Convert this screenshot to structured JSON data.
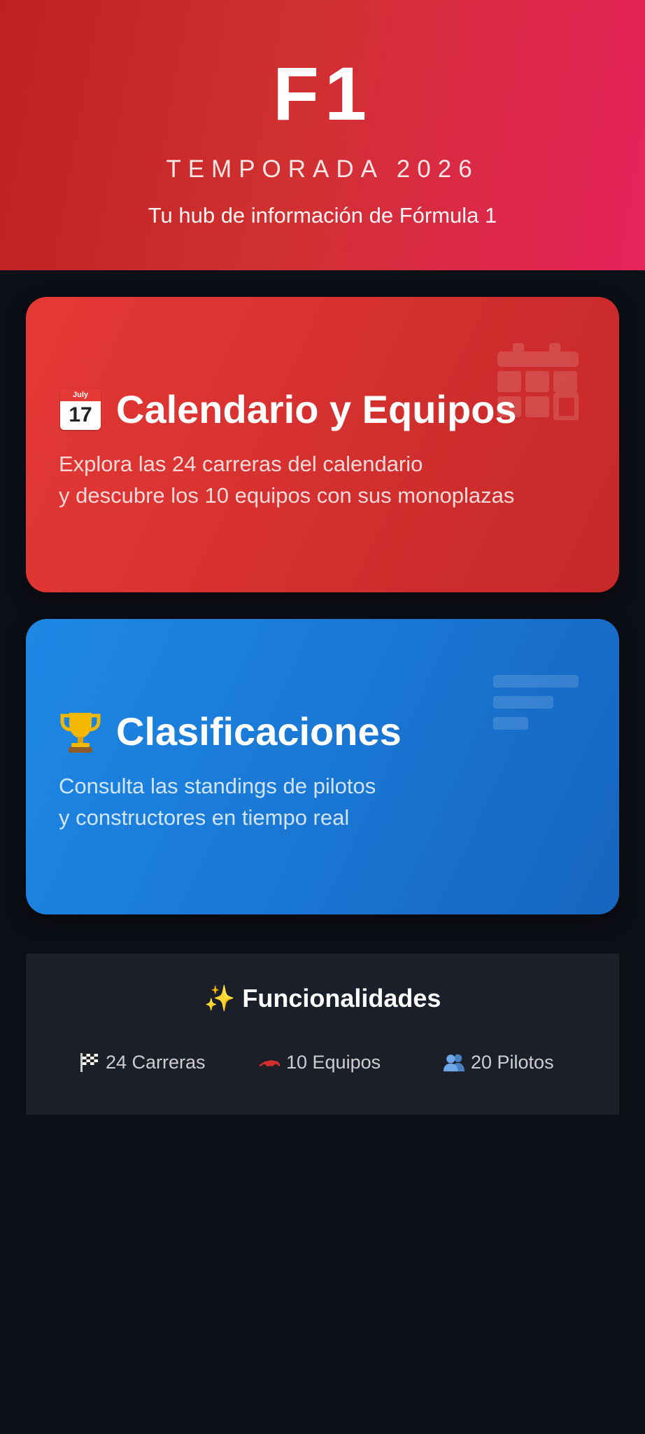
{
  "hero": {
    "logo": "F1",
    "season": "TEMPORADA 2026",
    "tagline": "Tu hub de información de Fórmula 1"
  },
  "cards": [
    {
      "icon": "calendar-icon",
      "icon_month": "July",
      "icon_day": "17",
      "title": "Calendario y Equipos",
      "desc_line1": "Explora las 24 carreras del calendario",
      "desc_line2": "y descubre los 10 equipos con sus monoplazas",
      "color": "#e53935"
    },
    {
      "icon": "trophy-icon",
      "title": "Clasificaciones",
      "desc_line1": "Consulta las standings de pilotos",
      "desc_line2": "y constructores en tiempo real",
      "color": "#1e88e5"
    }
  ],
  "features": {
    "title": "Funcionalidades",
    "title_icon": "sparkles-icon",
    "items": [
      {
        "icon": "checkered-flag-icon",
        "label": "24 Carreras"
      },
      {
        "icon": "race-car-icon",
        "label": "10 Equipos"
      },
      {
        "icon": "people-icon",
        "label": "20 Pilotos"
      }
    ]
  },
  "colors": {
    "background": "#0c0f16",
    "hero_start": "#bf1f22",
    "hero_end": "#e6235c",
    "panel": "#1b1f29"
  }
}
